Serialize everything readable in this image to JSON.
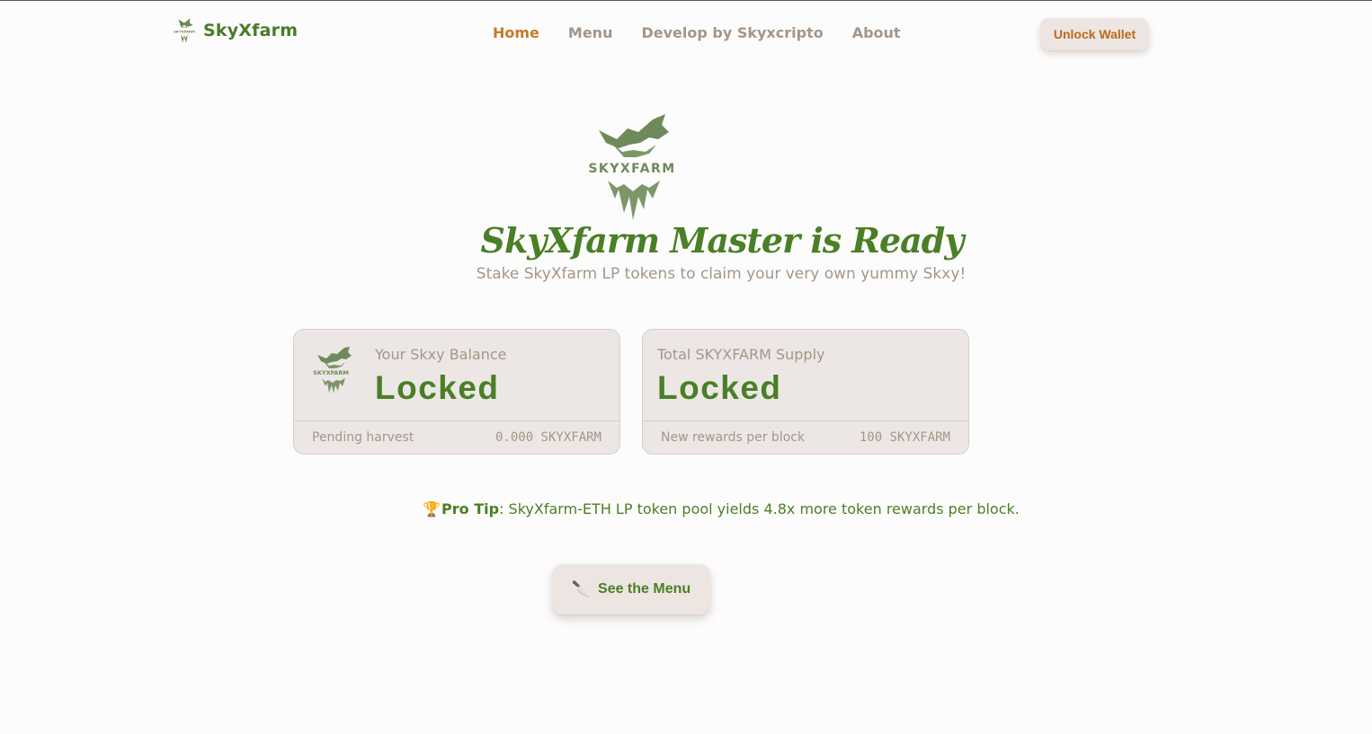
{
  "header": {
    "brand_name": "SkyXfarm",
    "nav": [
      {
        "label": "Home",
        "active": true
      },
      {
        "label": "Menu",
        "active": false
      },
      {
        "label": "Develop by Skyxcripto",
        "active": false
      },
      {
        "label": "About",
        "active": false
      }
    ],
    "unlock_label": "Unlock Wallet"
  },
  "hero": {
    "logo_text": "SKYXFARM",
    "title": "SkyXfarm Master is Ready",
    "subtitle": "Stake SkyXfarm LP tokens to claim your very own yummy Skxy!"
  },
  "cards": {
    "balance": {
      "label": "Your Skxy Balance",
      "value": "Locked",
      "footer_label": "Pending harvest",
      "footer_value": "0.000 SKYXFARM"
    },
    "supply": {
      "label": "Total SKYXFARM Supply",
      "value": "Locked",
      "footer_label": "New rewards per block",
      "footer_value": "100 SKYXFARM"
    }
  },
  "tip": {
    "icon": "trophy-icon",
    "bold": "Pro Tip",
    "text": ": SkyXfarm-ETH LP token pool yields 4.8x more token rewards per block."
  },
  "menu_button": {
    "icon": "knife-icon",
    "label": "See the Menu"
  },
  "colors": {
    "brand_green": "#4a7f26",
    "accent_orange": "#c47a2a",
    "muted_text": "#a39688",
    "card_bg": "#ece7e5",
    "logo_green": "#6f8a5a"
  }
}
